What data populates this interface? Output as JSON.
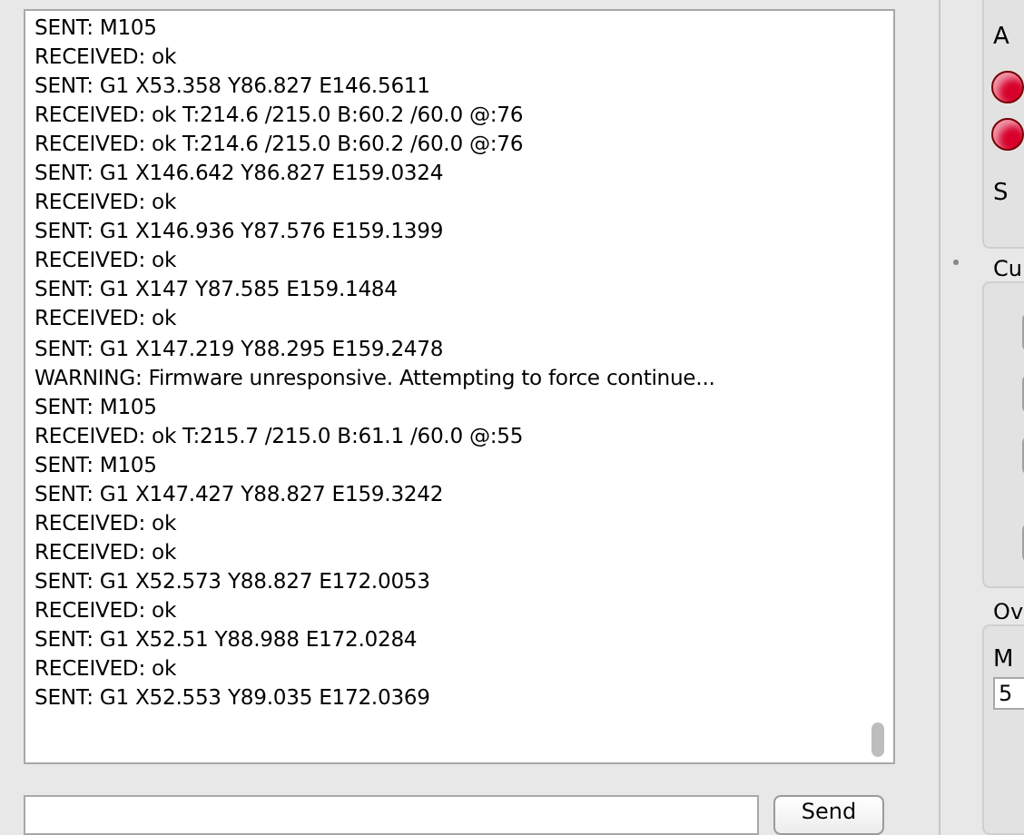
{
  "console": {
    "lines": [
      "SENT: M105",
      "RECEIVED: ok",
      "SENT: G1 X53.358 Y86.827 E146.5611",
      "RECEIVED: ok T:214.6 /215.0 B:60.2 /60.0 @:76",
      "RECEIVED: ok T:214.6 /215.0 B:60.2 /60.0 @:76",
      "SENT: G1 X146.642 Y86.827 E159.0324",
      "RECEIVED: ok",
      "SENT: G1 X146.936 Y87.576 E159.1399",
      "RECEIVED: ok",
      "SENT: G1 X147 Y87.585 E159.1484",
      "RECEIVED: ok",
      "SENT: G1 X147.219 Y88.295 E159.2478",
      "WARNING: Firmware unresponsive.  Attempting to force continue...",
      "SENT: M105",
      "RECEIVED: ok T:215.7 /215.0 B:61.1 /60.0 @:55",
      "SENT: M105",
      "SENT: G1 X147.427 Y88.827 E159.3242",
      "RECEIVED: ok",
      "RECEIVED: ok",
      "SENT: G1 X52.573 Y88.827 E172.0053",
      "RECEIVED: ok",
      "SENT: G1 X52.51 Y88.988 E172.0284",
      "RECEIVED: ok",
      "SENT: G1 X52.553 Y89.035 E172.0369"
    ]
  },
  "command": {
    "send_button": "Send"
  },
  "right_panel": {
    "status_group": {
      "label_1": "A",
      "lights": [
        {
          "color": "#d8002c"
        },
        {
          "color": "#d8002c"
        }
      ],
      "label_2": "S"
    },
    "custom_group": {
      "title": "Cu"
    },
    "override_group": {
      "title": "Ov",
      "label": "M",
      "value": "5"
    }
  }
}
